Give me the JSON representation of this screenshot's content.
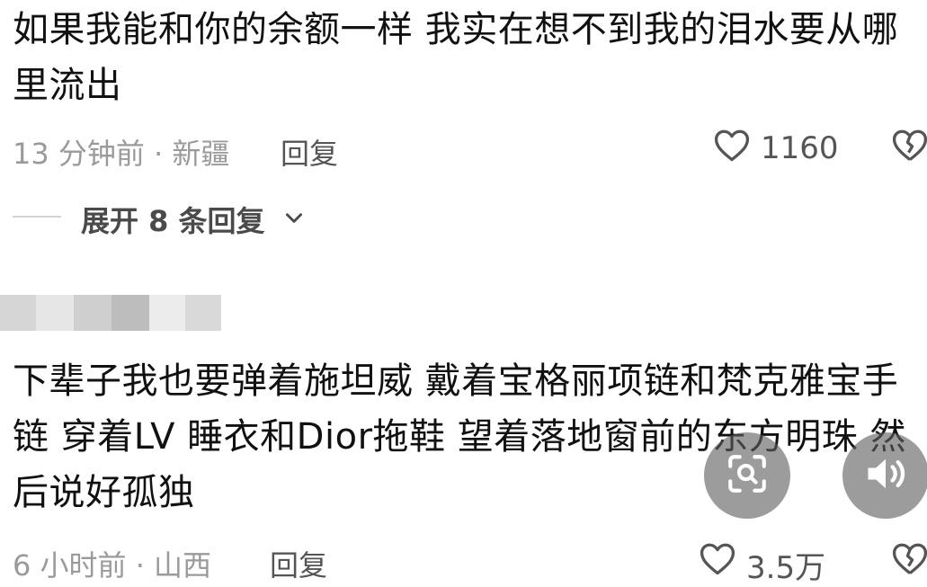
{
  "comments": [
    {
      "text_line1": "如果我能和你的余额一样 我实在想不到我的泪水要从哪",
      "text_line2": "里流出",
      "time_location": "13 分钟前 · 新疆",
      "reply_label": "回复",
      "like_count": "1160",
      "expand_replies_label": "展开 8 条回复"
    },
    {
      "text_line1": "下辈子我也要弹着施坦威 戴着宝格丽项链和梵克雅宝手",
      "text_line2": "链 穿着LV 睡衣和Dior拖鞋  望着落地窗前的东方明珠 然",
      "text_line3": "后说好孤独",
      "time_location": "6 小时前 · 山西",
      "reply_label": "回复",
      "like_count": "3.5万"
    }
  ],
  "icons": {
    "like": "heart-icon",
    "dislike": "broken-heart-icon",
    "expand": "chevron-down-icon",
    "search": "image-search-icon",
    "sound": "speaker-icon"
  },
  "colors": {
    "text": "#111111",
    "meta": "#9a9a9a",
    "float_button": "#5f5f5f"
  }
}
